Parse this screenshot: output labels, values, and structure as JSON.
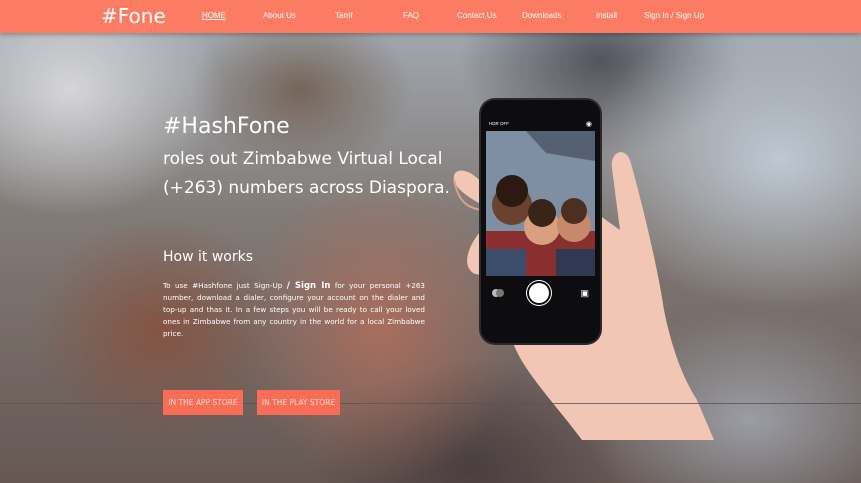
{
  "brand": {
    "logo": "#Fone"
  },
  "nav": {
    "home": "HOME",
    "about": "About Us",
    "tarrif": "Tarrif",
    "faq": "FAQ",
    "contact": "Contact Us",
    "downloads": "Downloads",
    "install": "Install",
    "signin": "Sign In / Sign Up"
  },
  "hero": {
    "title": "#HashFone",
    "subtitle_line1": "roles out Zimbabwe Virtual Local",
    "subtitle_line2": "(+263) numbers across Diaspora.",
    "how_heading": "How it works",
    "body_part1": "To use #Hashfone just Sign-Up",
    "body_bold": "/ Sign In",
    "body_part2": "for your personal +263 number, download a dialer, configure your account on the dialer and top-up and thas it. In a few steps you will be ready to call your loved ones in Zimbabwe from any country in the world for a local Zimbabwe price."
  },
  "buttons": {
    "app_store": "IN THE APP STORE",
    "play_store": "IN THE PLAY STORE"
  },
  "phone": {
    "status": "HDR  OFF"
  },
  "colors": {
    "nav_bg": "#fb7b63",
    "button_bg": "#f96c55",
    "text": "#ffffff"
  }
}
